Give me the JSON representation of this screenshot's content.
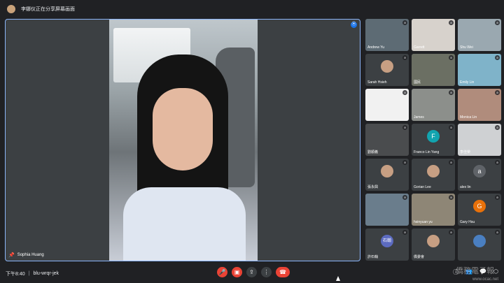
{
  "topbar": {
    "presenting_text": "李娜仪正在分享屏幕画面"
  },
  "main_tile": {
    "name": "Sophia Huang",
    "pin_icon": "pin-icon",
    "accent": "#8ab4f8"
  },
  "participants": [
    {
      "name": "Andrew Yu",
      "kind": "video",
      "bg": "#5d6b74"
    },
    {
      "name": "Garrett",
      "kind": "video",
      "bg": "#d7d2cc"
    },
    {
      "name": "Shu Wei",
      "kind": "video",
      "bg": "#9aa8b0"
    },
    {
      "name": "Sarah Hsieh",
      "kind": "photo",
      "bg": "#3c4043"
    },
    {
      "name": "國民",
      "kind": "video",
      "bg": "#6b6f63"
    },
    {
      "name": "Emily Lin",
      "kind": "video",
      "bg": "#7fb3c9"
    },
    {
      "name": "",
      "kind": "video",
      "bg": "#f1f1f1"
    },
    {
      "name": "James",
      "kind": "video",
      "bg": "#8c8f8b"
    },
    {
      "name": "Monica Lin",
      "kind": "video",
      "bg": "#b08c7c"
    },
    {
      "name": "劉順義",
      "kind": "video",
      "bg": "#4a4c4e"
    },
    {
      "name": "Franco Lin Yang",
      "kind": "letter",
      "letter": "F",
      "color": "#12a4af"
    },
    {
      "name": "李佳榮",
      "kind": "video",
      "bg": "#cfd1d3"
    },
    {
      "name": "張永興",
      "kind": "photo",
      "bg": "#3c4043"
    },
    {
      "name": "Gorian Lee",
      "kind": "photo",
      "bg": "#3c4043"
    },
    {
      "name": "alex lin",
      "kind": "letter",
      "letter": "a",
      "color": "#5f6368"
    },
    {
      "name": "",
      "kind": "video",
      "bg": "#6a7d8c"
    },
    {
      "name": "hsinyuan yu",
      "kind": "video",
      "bg": "#8e8676"
    },
    {
      "name": "Gary Hsu",
      "kind": "letter",
      "letter": "G",
      "color": "#e8710a"
    },
    {
      "name": "許石翰",
      "kind": "letter",
      "letter": "石翰",
      "color": "#5c6bc0"
    },
    {
      "name": "僑委會",
      "kind": "photo",
      "bg": "#3c4043"
    },
    {
      "name": "",
      "kind": "logo",
      "bg": "#3c4043"
    }
  ],
  "bottombar": {
    "time": "下午8:40",
    "meeting_code": "blu-wrqr-jek"
  },
  "watermark": {
    "text": "僑務電子報",
    "url": "www.ocac.net"
  }
}
